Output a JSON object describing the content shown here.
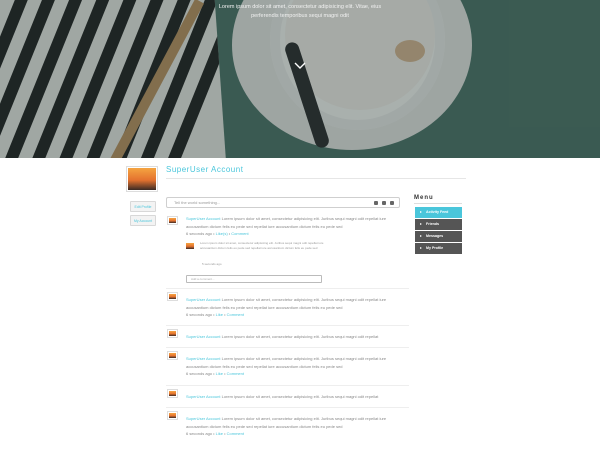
{
  "hero": {
    "tagline_1": "Lorem ipsum dolor sit amet, consectetur adipisicing elit. Vitae, eius",
    "tagline_2": "perferendis temporibus sequi magni odit"
  },
  "profile": {
    "name": "SuperUser Account",
    "buttons": [
      "Edit Profile",
      "My Account"
    ]
  },
  "composer": {
    "placeholder": "Tell the world something...",
    "icons": [
      "camera-icon",
      "attachment-icon",
      "eye-icon"
    ]
  },
  "feed": [
    {
      "author": "SuperUser Account",
      "text": "Lorem ipsum dolor sit amet, consectetur adipisicing elit. Juribus sequi magni odit repellat iure accusantium dictum felis eu pede sed repellat iure accusantium dictum felis eu pede sed",
      "time": "6 seconds ago",
      "likes": "Like(s)",
      "comment": "Comment",
      "reply": {
        "text": "Lorem ipsum dolor sit amet, consectetur adipisicing elit. Juribus sequi magni odit repellat iure accusantium dictum felis eu pede sed repellat iure accusantium dictum felis eu pede sed",
        "time": "5 seconds ago"
      },
      "comment_placeholder": "Add a comment..."
    },
    {
      "author": "SuperUser Account",
      "text": "Lorem ipsum dolor sit amet, consectetur adipisicing elit. Juribus sequi magni odit repellat iure accusantium dictum felis eu pede sed repellat iure accusantium dictum felis eu pede sed",
      "time": "6 seconds ago",
      "likes": "Like",
      "comment": "Comment"
    },
    {
      "author": "SuperUser Account",
      "text": "Lorem ipsum dolor sit amet, consectetur adipisicing elit. Juribus sequi magni odit repellat",
      "time": "",
      "likes": "",
      "comment": ""
    },
    {
      "author": "SuperUser Account",
      "text": "Lorem ipsum dolor sit amet, consectetur adipisicing elit. Juribus sequi magni odit repellat iure accusantium dictum felis eu pede sed repellat iure accusantium dictum felis eu pede sed",
      "time": "6 seconds ago",
      "likes": "Like",
      "comment": "Comment"
    },
    {
      "author": "SuperUser Account",
      "text": "Lorem ipsum dolor sit amet, consectetur adipisicing elit. Juribus sequi magni odit repellat",
      "time": "",
      "likes": "",
      "comment": ""
    },
    {
      "author": "SuperUser Account",
      "text": "Lorem ipsum dolor sit amet, consectetur adipisicing elit. Juribus sequi magni odit repellat iure accusantium dictum felis eu pede sed repellat iure accusantium dictum felis eu pede sed",
      "time": "6 seconds ago",
      "likes": "Like",
      "comment": "Comment"
    }
  ],
  "menu": {
    "title": "Menu",
    "items": [
      "Activity Feed",
      "Friends",
      "Messages",
      "My Profile"
    ],
    "active_index": 0
  },
  "colors": {
    "accent": "#4ac6db",
    "menu_bg": "#555555",
    "hero_tint": "#4a7166"
  }
}
